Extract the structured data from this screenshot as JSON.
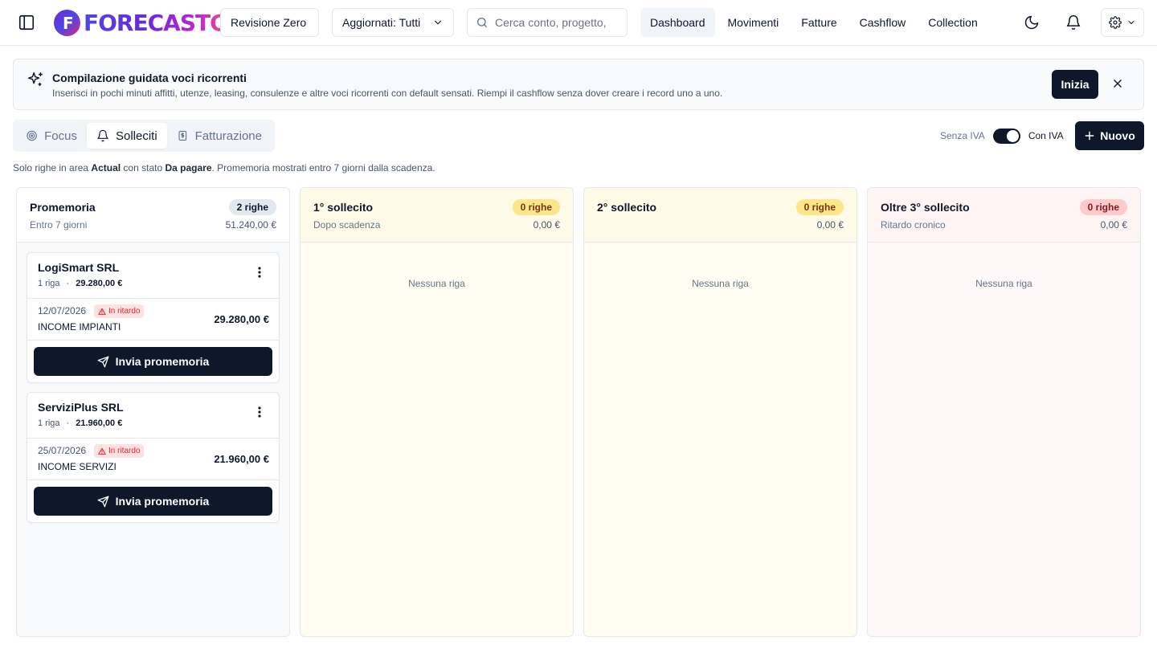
{
  "app": {
    "logo_mark": "F",
    "logo_text": "FORECASTC"
  },
  "topbar": {
    "revision_label": "Revisione Zero",
    "updated_label": "Aggiornati: Tutti",
    "search_placeholder": "Cerca conto, progetto,",
    "nav": [
      {
        "label": "Dashboard",
        "active": true
      },
      {
        "label": "Movimenti"
      },
      {
        "label": "Fatture"
      },
      {
        "label": "Cashflow"
      },
      {
        "label": "Collection"
      }
    ],
    "icons": [
      "sidebar-toggle-icon",
      "moon-icon",
      "bell-icon",
      "gear-icon",
      "chevron-down-icon",
      "search-icon"
    ]
  },
  "banner": {
    "title": "Compilazione guidata voci ricorrenti",
    "description": "Inserisci in pochi minuti affitti, utenze, leasing, consulenze e altre voci ricorrenti con default sensati. Riempi il cashflow senza dover creare i record uno a uno.",
    "start_label": "Inizia",
    "icon": "sparkles-icon"
  },
  "tabs": [
    {
      "label": "Focus",
      "icon": "target-icon"
    },
    {
      "label": "Solleciti",
      "icon": "bell-icon",
      "active": true
    },
    {
      "label": "Fatturazione",
      "icon": "receipt-icon"
    }
  ],
  "vat": {
    "off_label": "Senza IVA",
    "on_label": "Con IVA",
    "enabled": true
  },
  "new_button_label": "Nuovo",
  "info": {
    "prefix": "Solo righe in area ",
    "area": "Actual",
    "middle": " con stato ",
    "status": "Da pagare",
    "suffix": ". Promemoria mostrati entro 7 giorni dalla scadenza."
  },
  "columns": [
    {
      "title": "Promemoria",
      "subtitle": "Entro 7 giorni",
      "badge": "2 righe",
      "total": "51.240,00 €",
      "colors": {
        "badge_bg": "#e2e8f0",
        "badge_fg": "#0f172a"
      },
      "cards": [
        {
          "name": "LogiSmart SRL",
          "count": "1 riga",
          "amount": "29.280,00 €",
          "row": {
            "date": "12/07/2026",
            "status": "In ritardo",
            "description": "INCOME IMPIANTI",
            "amount": "29.280,00 €"
          },
          "action": "Invia promemoria"
        },
        {
          "name": "ServiziPlus SRL",
          "count": "1 riga",
          "amount": "21.960,00 €",
          "row": {
            "date": "25/07/2026",
            "status": "In ritardo",
            "description": "INCOME SERVIZI",
            "amount": "21.960,00 €"
          },
          "action": "Invia promemoria"
        }
      ]
    },
    {
      "title": "1° sollecito",
      "subtitle": "Dopo scadenza",
      "badge": "0 righe",
      "total": "0,00 €",
      "empty": "Nessuna riga",
      "colors": {
        "badge_bg": "#fde68a",
        "badge_fg": "#78350f"
      }
    },
    {
      "title": "2° sollecito",
      "subtitle": "",
      "badge": "0 righe",
      "total": "0,00 €",
      "empty": "Nessuna riga",
      "colors": {
        "badge_bg": "#fde68a",
        "badge_fg": "#78350f"
      }
    },
    {
      "title": "Oltre 3° sollecito",
      "subtitle": "Ritardo cronico",
      "badge": "0 righe",
      "total": "0,00 €",
      "empty": "Nessuna riga",
      "colors": {
        "badge_bg": "#fecaca",
        "badge_fg": "#7f1d1d"
      }
    }
  ]
}
